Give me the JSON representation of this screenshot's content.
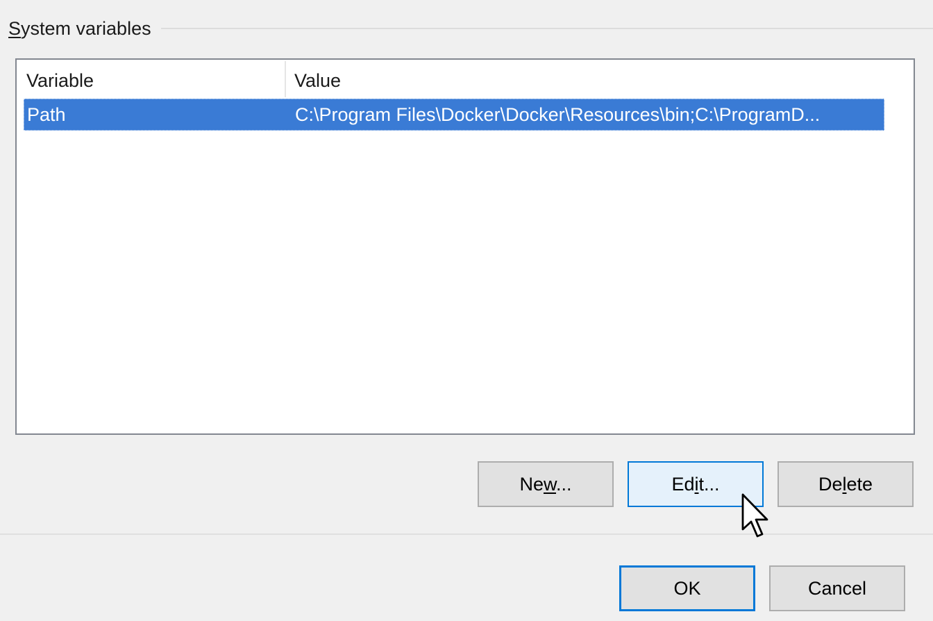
{
  "group": {
    "title_accel": "S",
    "title_rest": "ystem variables"
  },
  "list": {
    "columns": [
      "Variable",
      "Value"
    ],
    "rows": [
      {
        "variable": "Path",
        "value": "C:\\Program Files\\Docker\\Docker\\Resources\\bin;C:\\ProgramD...",
        "selected": true
      }
    ]
  },
  "buttons": {
    "new": {
      "pre": "Ne",
      "accel": "w",
      "post": "..."
    },
    "edit": {
      "pre": "Ed",
      "accel": "i",
      "post": "t..."
    },
    "delete": {
      "pre": "De",
      "accel": "l",
      "post": "ete"
    },
    "ok": "OK",
    "cancel": "Cancel"
  },
  "colors": {
    "selection": "#3a7bd5",
    "focus_border": "#0078d7",
    "hover_bg": "#e5f1fb",
    "window_bg": "#f0f0f0"
  },
  "icons": {
    "cursor": "arrow-cursor-icon"
  }
}
